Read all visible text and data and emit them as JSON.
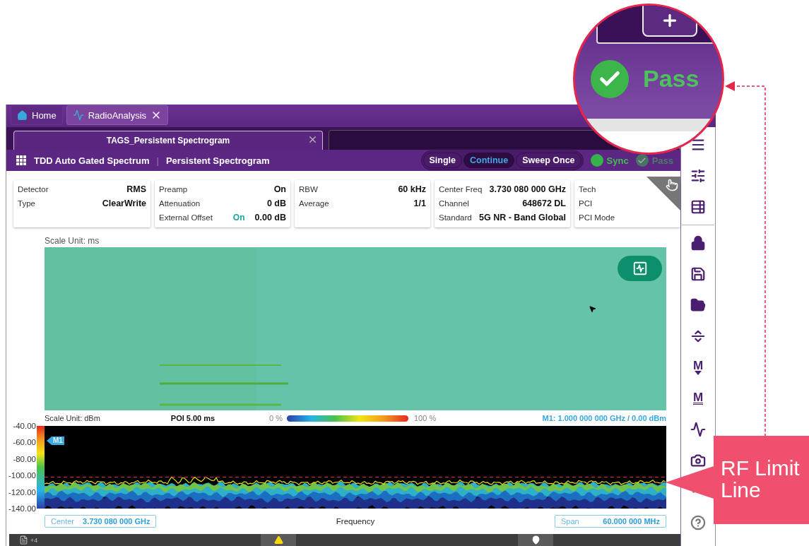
{
  "app_tabs": [
    {
      "kind": "home",
      "label": "Home",
      "selected": false,
      "closable": false
    },
    {
      "kind": "app",
      "label": "RadioAnalysis",
      "selected": true,
      "closable": true
    }
  ],
  "document_tab": {
    "label": "TAGS_Persistent Spectrogram",
    "selected": true
  },
  "header": {
    "mode": "TDD Auto Gated Spectrum",
    "separator": "|",
    "view": "Persistent Spectrogram"
  },
  "sweep_buttons": [
    {
      "label": "Single",
      "selected": false
    },
    {
      "label": "Continue",
      "selected": true
    },
    {
      "label": "Sweep Once",
      "selected": false
    }
  ],
  "indicators": [
    {
      "kind": "dot",
      "label": "Sync"
    },
    {
      "kind": "check",
      "label": "Pass"
    }
  ],
  "info_cards": [
    {
      "rows": [
        {
          "label": "Detector",
          "value": "RMS"
        },
        {
          "label": "Type",
          "value": "ClearWrite"
        }
      ]
    },
    {
      "rows": [
        {
          "label": "Preamp",
          "value": "On"
        },
        {
          "label": "Attenuation",
          "value": "0 dB"
        },
        {
          "label": "External Offset",
          "status": "On",
          "value": "0.00 dB"
        }
      ]
    },
    {
      "rows": [
        {
          "label": "RBW",
          "value": "60 kHz"
        },
        {
          "label": "Average",
          "value": "1/1"
        }
      ]
    },
    {
      "rows": [
        {
          "label": "Center Freq",
          "value": "3.730 080 000 GHz"
        },
        {
          "label": "Channel",
          "value": "648672 DL"
        },
        {
          "label": "Standard",
          "value": "5G NR - Band Global"
        }
      ]
    },
    {
      "rows": [
        {
          "label": "Tech"
        },
        {
          "label": "PCI"
        },
        {
          "label": "PCI Mode"
        }
      ]
    }
  ],
  "spectrogram": {
    "scale_unit": "Scale Unit: ms"
  },
  "spectrum": {
    "scale_unit": "Scale Unit: dBm",
    "poi": "POI 5.00 ms",
    "legend_min": "0 %",
    "legend_max": "100 %",
    "marker_readout": "M1: 1.000 000 000 GHz / 0.00 dBm",
    "marker_label": "M1",
    "y_labels": [
      "-40.00",
      "-60.00",
      "-80.00",
      "-100.00",
      "-120.00",
      "-140.00"
    ],
    "center": {
      "label": "Center",
      "value": "3.730 080 000 GHz"
    },
    "xlabel": "Frequency",
    "span": {
      "label": "Span",
      "value": "60.000 000 MHz"
    }
  },
  "status_bar": {
    "notes_count": "+4"
  },
  "sidebar": [
    {
      "kind": "menu"
    },
    {
      "kind": "settings"
    },
    {
      "kind": "table"
    },
    {
      "kind": "divider"
    },
    {
      "kind": "lock"
    },
    {
      "kind": "save"
    },
    {
      "kind": "open"
    },
    {
      "kind": "split"
    },
    {
      "kind": "marker-down",
      "label": "M"
    },
    {
      "kind": "marker-table",
      "label": "M"
    },
    {
      "kind": "peak"
    },
    {
      "kind": "camera"
    },
    {
      "kind": "more"
    },
    {
      "kind": "help"
    }
  ],
  "magnifier": {
    "label": "Pass"
  },
  "callout": {
    "text": "RF Limit Line"
  }
}
